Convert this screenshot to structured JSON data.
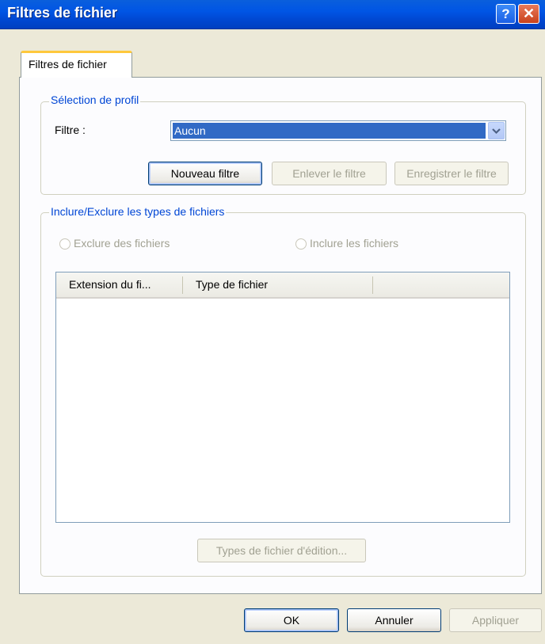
{
  "window": {
    "title": "Filtres de fichier"
  },
  "tab": {
    "label": "Filtres de fichier"
  },
  "profile": {
    "legend": "Sélection de profil",
    "filter_label": "Filtre :",
    "filter_value": "Aucun",
    "new_button": "Nouveau filtre",
    "remove_button": "Enlever le filtre",
    "save_button": "Enregistrer le filtre"
  },
  "types": {
    "legend": "Inclure/Exclure les types de fichiers",
    "exclude_label": "Exclure des fichiers",
    "include_label": "Inclure les fichiers",
    "columns": [
      "Extension du fi...",
      "Type de fichier"
    ],
    "rows": [],
    "edit_button": "Types de fichier d'édition..."
  },
  "footer": {
    "ok": "OK",
    "cancel": "Annuler",
    "apply": "Appliquer"
  },
  "colors": {
    "title_bar": "#0055e5",
    "selection": "#316ac5",
    "legend": "#0046d5"
  }
}
